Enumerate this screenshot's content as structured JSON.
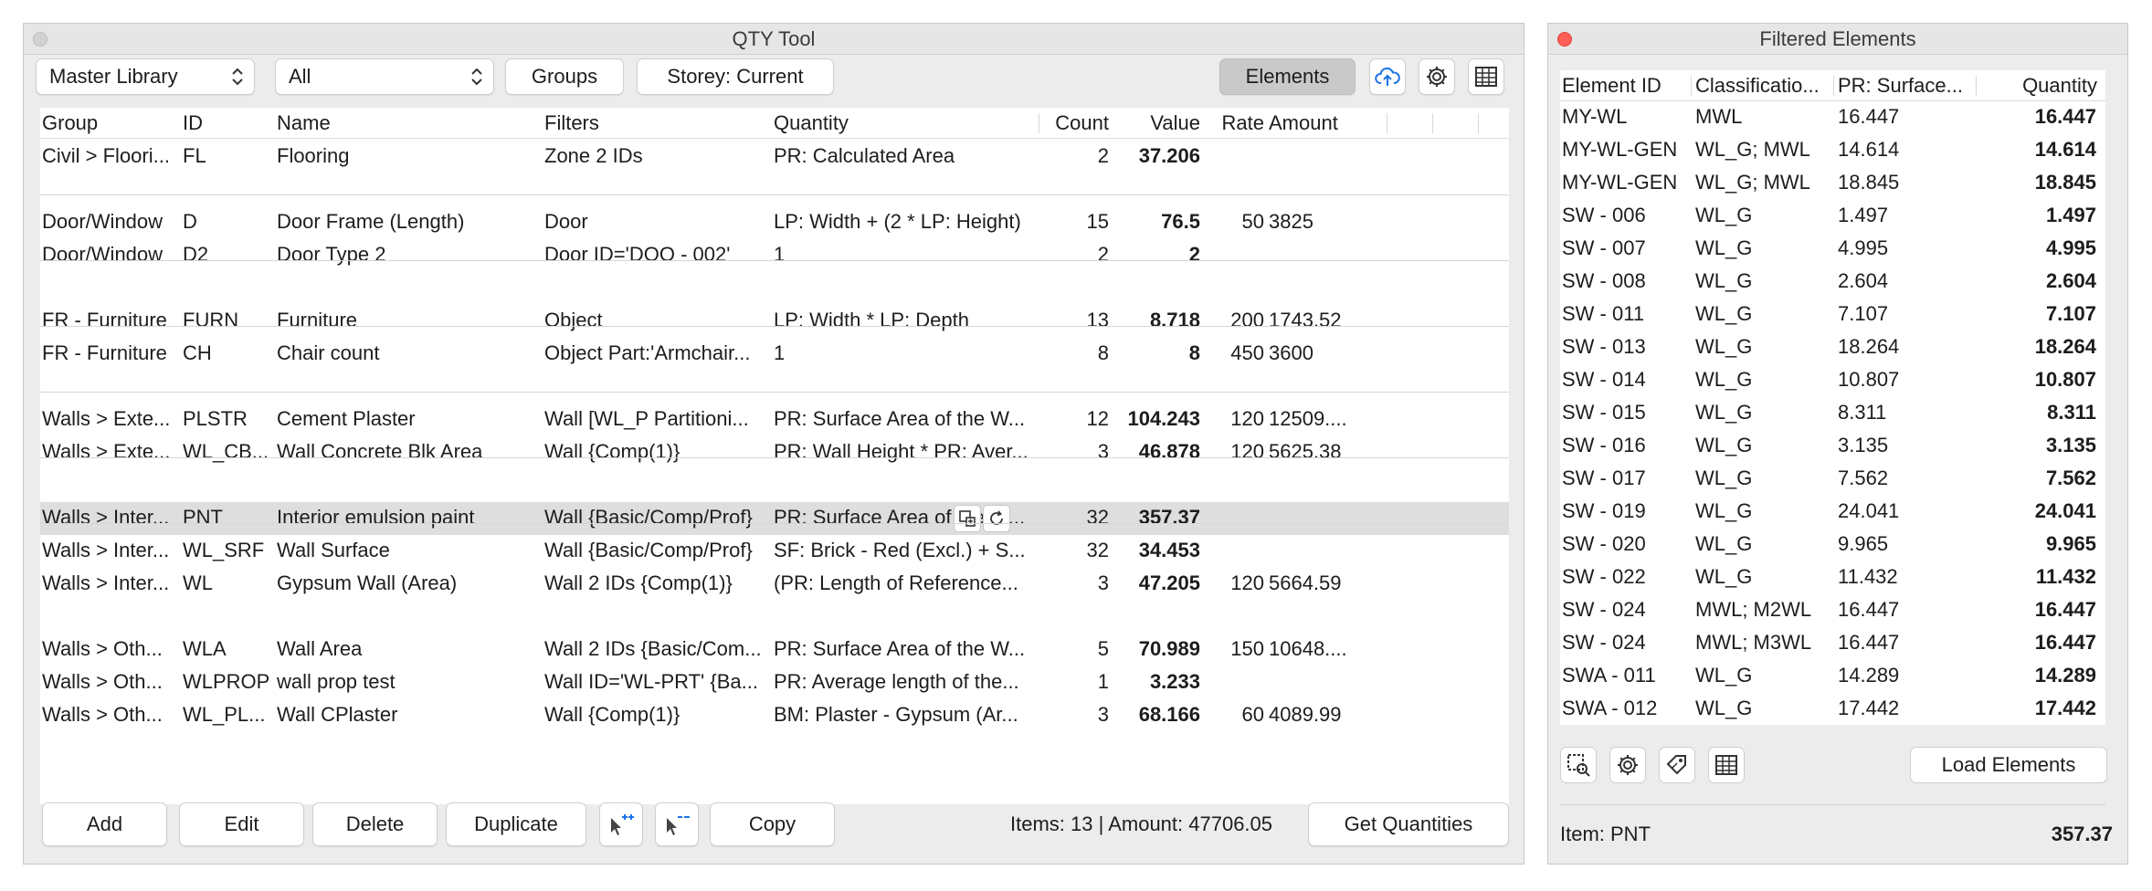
{
  "qty_window": {
    "title": "QTY Tool",
    "toolbar": {
      "library_select": "Master Library",
      "filter_select": "All",
      "groups_label": "Groups",
      "storey_label": "Storey: Current",
      "elements_label": "Elements",
      "icons": [
        "cloud-upload-icon",
        "gear-icon",
        "table-icon"
      ]
    },
    "columns": [
      "Group",
      "ID",
      "Name",
      "Filters",
      "Quantity",
      "Count",
      "Value",
      "Rate",
      "Amount"
    ],
    "rows": [
      {
        "group": "Civil > Floori...",
        "id": "FL",
        "name": "Flooring",
        "filters": "Zone 2 IDs",
        "quantity": "PR: Calculated Area",
        "count": "2",
        "value": "37.206",
        "rate": "",
        "amount": ""
      },
      {
        "group": "Door/Window",
        "id": "D",
        "name": "Door Frame (Length)",
        "filters": "Door",
        "quantity": "LP: Width + (2 * LP: Height)",
        "count": "15",
        "value": "76.5",
        "rate": "50",
        "amount": "3825"
      },
      {
        "group": "Door/Window",
        "id": "D2",
        "name": "Door Type 2",
        "filters": "Door ID='DOO - 002'",
        "quantity": "1",
        "count": "2",
        "value": "2",
        "rate": "",
        "amount": ""
      },
      {
        "group": "FR - Furniture",
        "id": "FURN",
        "name": "Furniture",
        "filters": "Object",
        "quantity": "LP: Width * LP: Depth",
        "count": "13",
        "value": "8.718",
        "rate": "200",
        "amount": "1743.52"
      },
      {
        "group": "FR - Furniture",
        "id": "CH",
        "name": "Chair count",
        "filters": "Object Part:'Armchair...",
        "quantity": "1",
        "count": "8",
        "value": "8",
        "rate": "450",
        "amount": "3600"
      },
      {
        "group": "Walls > Exte...",
        "id": "PLSTR",
        "name": "Cement Plaster",
        "filters": "Wall [WL_P Partitioni...",
        "quantity": "PR: Surface Area of the W...",
        "count": "12",
        "value": "104.243",
        "rate": "120",
        "amount": "12509...."
      },
      {
        "group": "Walls > Exte...",
        "id": "WL_CB...",
        "name": "Wall Concrete Blk Area",
        "filters": "Wall {Comp(1)}",
        "quantity": "PR: Wall Height * PR: Aver...",
        "count": "3",
        "value": "46.878",
        "rate": "120",
        "amount": "5625.38"
      },
      {
        "group": "Walls > Inter...",
        "id": "PNT",
        "name": "Interior emulsion paint",
        "filters": "Wall {Basic/Comp/Prof}",
        "quantity": "PR: Surface Area of the W...",
        "count": "32",
        "value": "357.37",
        "rate": "",
        "amount": ""
      },
      {
        "group": "Walls > Inter...",
        "id": "WL_SRF",
        "name": "Wall Surface",
        "filters": "Wall {Basic/Comp/Prof}",
        "quantity": "SF: Brick - Red (Excl.) + S...",
        "count": "32",
        "value": "34.453",
        "rate": "",
        "amount": ""
      },
      {
        "group": "Walls > Inter...",
        "id": "WL",
        "name": "Gypsum Wall (Area)",
        "filters": "Wall 2 IDs {Comp(1)}",
        "quantity": "(PR: Length of Reference...",
        "count": "3",
        "value": "47.205",
        "rate": "120",
        "amount": "5664.59"
      },
      {
        "group": "Walls > Oth...",
        "id": "WLA",
        "name": "Wall Area",
        "filters": "Wall 2 IDs {Basic/Com...",
        "quantity": "PR: Surface Area of the W...",
        "count": "5",
        "value": "70.989",
        "rate": "150",
        "amount": "10648...."
      },
      {
        "group": "Walls > Oth...",
        "id": "WLPROP",
        "name": "wall prop test",
        "filters": "Wall ID='WL-PRT' {Ba...",
        "quantity": "PR: Average length of the...",
        "count": "1",
        "value": "3.233",
        "rate": "",
        "amount": ""
      },
      {
        "group": "Walls > Oth...",
        "id": "WL_PL...",
        "name": "Wall CPlaster",
        "filters": "Wall {Comp(1)}",
        "quantity": "BM: Plaster - Gypsum (Ar...",
        "count": "3",
        "value": "68.166",
        "rate": "60",
        "amount": "4089.99"
      }
    ],
    "buttons": {
      "add": "Add",
      "edit": "Edit",
      "delete": "Delete",
      "duplicate": "Duplicate",
      "copy": "Copy",
      "get_quantities": "Get Quantities"
    },
    "status": "Items: 13 | Amount: 47706.05"
  },
  "filtered_window": {
    "title": "Filtered Elements",
    "columns": [
      "Element ID",
      "Classificatio...",
      "PR: Surface...",
      "Quantity"
    ],
    "rows": [
      {
        "id": "MY-WL",
        "cls": "MWL",
        "pr": "16.447",
        "qty": "16.447"
      },
      {
        "id": "MY-WL-GEN",
        "cls": "WL_G; MWL",
        "pr": "14.614",
        "qty": "14.614"
      },
      {
        "id": "MY-WL-GEN",
        "cls": "WL_G; MWL",
        "pr": "18.845",
        "qty": "18.845"
      },
      {
        "id": "SW - 006",
        "cls": "WL_G",
        "pr": "1.497",
        "qty": "1.497"
      },
      {
        "id": "SW - 007",
        "cls": "WL_G",
        "pr": "4.995",
        "qty": "4.995"
      },
      {
        "id": "SW - 008",
        "cls": "WL_G",
        "pr": "2.604",
        "qty": "2.604"
      },
      {
        "id": "SW - 011",
        "cls": "WL_G",
        "pr": "7.107",
        "qty": "7.107"
      },
      {
        "id": "SW - 013",
        "cls": "WL_G",
        "pr": "18.264",
        "qty": "18.264"
      },
      {
        "id": "SW - 014",
        "cls": "WL_G",
        "pr": "10.807",
        "qty": "10.807"
      },
      {
        "id": "SW - 015",
        "cls": "WL_G",
        "pr": "8.311",
        "qty": "8.311"
      },
      {
        "id": "SW - 016",
        "cls": "WL_G",
        "pr": "3.135",
        "qty": "3.135"
      },
      {
        "id": "SW - 017",
        "cls": "WL_G",
        "pr": "7.562",
        "qty": "7.562"
      },
      {
        "id": "SW - 019",
        "cls": "WL_G",
        "pr": "24.041",
        "qty": "24.041"
      },
      {
        "id": "SW - 020",
        "cls": "WL_G",
        "pr": "9.965",
        "qty": "9.965"
      },
      {
        "id": "SW - 022",
        "cls": "WL_G",
        "pr": "11.432",
        "qty": "11.432"
      },
      {
        "id": "SW - 024",
        "cls": "MWL; M2WL",
        "pr": "16.447",
        "qty": "16.447"
      },
      {
        "id": "SW - 024",
        "cls": "MWL; M3WL",
        "pr": "16.447",
        "qty": "16.447"
      },
      {
        "id": "SWA - 011",
        "cls": "WL_G",
        "pr": "14.289",
        "qty": "14.289"
      },
      {
        "id": "SWA - 012",
        "cls": "WL_G",
        "pr": "17.442",
        "qty": "17.442"
      }
    ],
    "load_label": "Load Elements",
    "status_item": "Item: PNT",
    "status_value": "357.37",
    "icons": [
      "select-element-icon",
      "gear-icon",
      "tag-icon",
      "table-icon"
    ]
  },
  "colors": {
    "selected_row": "#dedede",
    "close_red": "#ff5f57",
    "accent_blue": "#1a73e8"
  }
}
